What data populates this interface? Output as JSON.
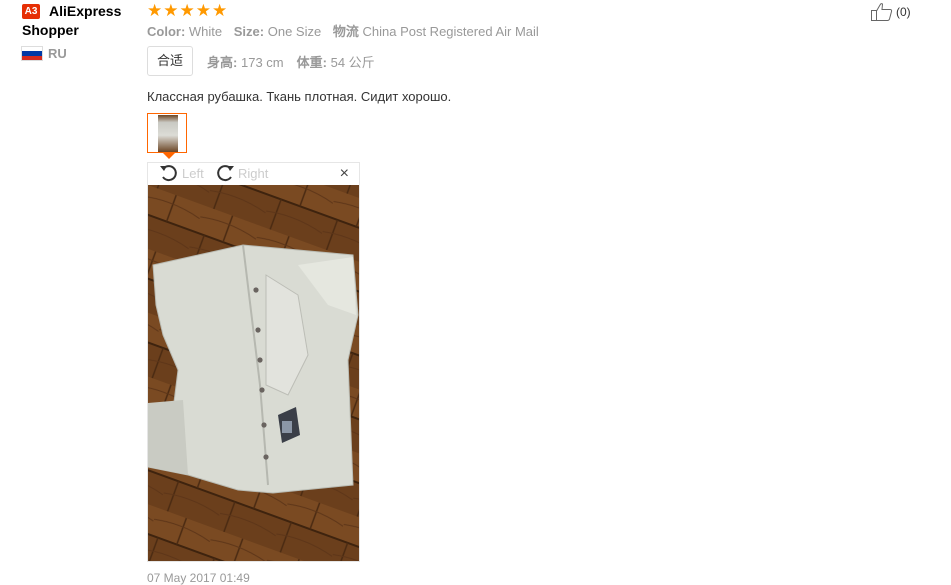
{
  "user": {
    "level_badge": "A3",
    "name_line1": "AliExpress",
    "name_line2": "Shopper",
    "country": "RU",
    "flag_icon": "russia-flag-icon"
  },
  "review": {
    "rating_stars": 5,
    "rating_max": 5,
    "attributes": [
      {
        "label": "Color:",
        "value": "White"
      },
      {
        "label": "Size:",
        "value": "One Size"
      },
      {
        "label": "物流",
        "value": "China Post Registered Air Mail"
      }
    ],
    "fit": {
      "badge": "合适",
      "height_label": "身高:",
      "height_value": "173 cm",
      "weight_label": "体重:",
      "weight_value": "54 公斤"
    },
    "text": "Классная рубашка. Ткань плотная. Сидит хорошо.",
    "date": "07 May 2017 01:49"
  },
  "viewer": {
    "rotate_left": "Left",
    "rotate_right": "Right",
    "close": "×"
  },
  "helpful": {
    "count": "(0)",
    "icon": "thumbs-up-icon"
  },
  "colors": {
    "accent": "#ff6600",
    "star": "#ff9900",
    "badge": "#e62e04"
  }
}
